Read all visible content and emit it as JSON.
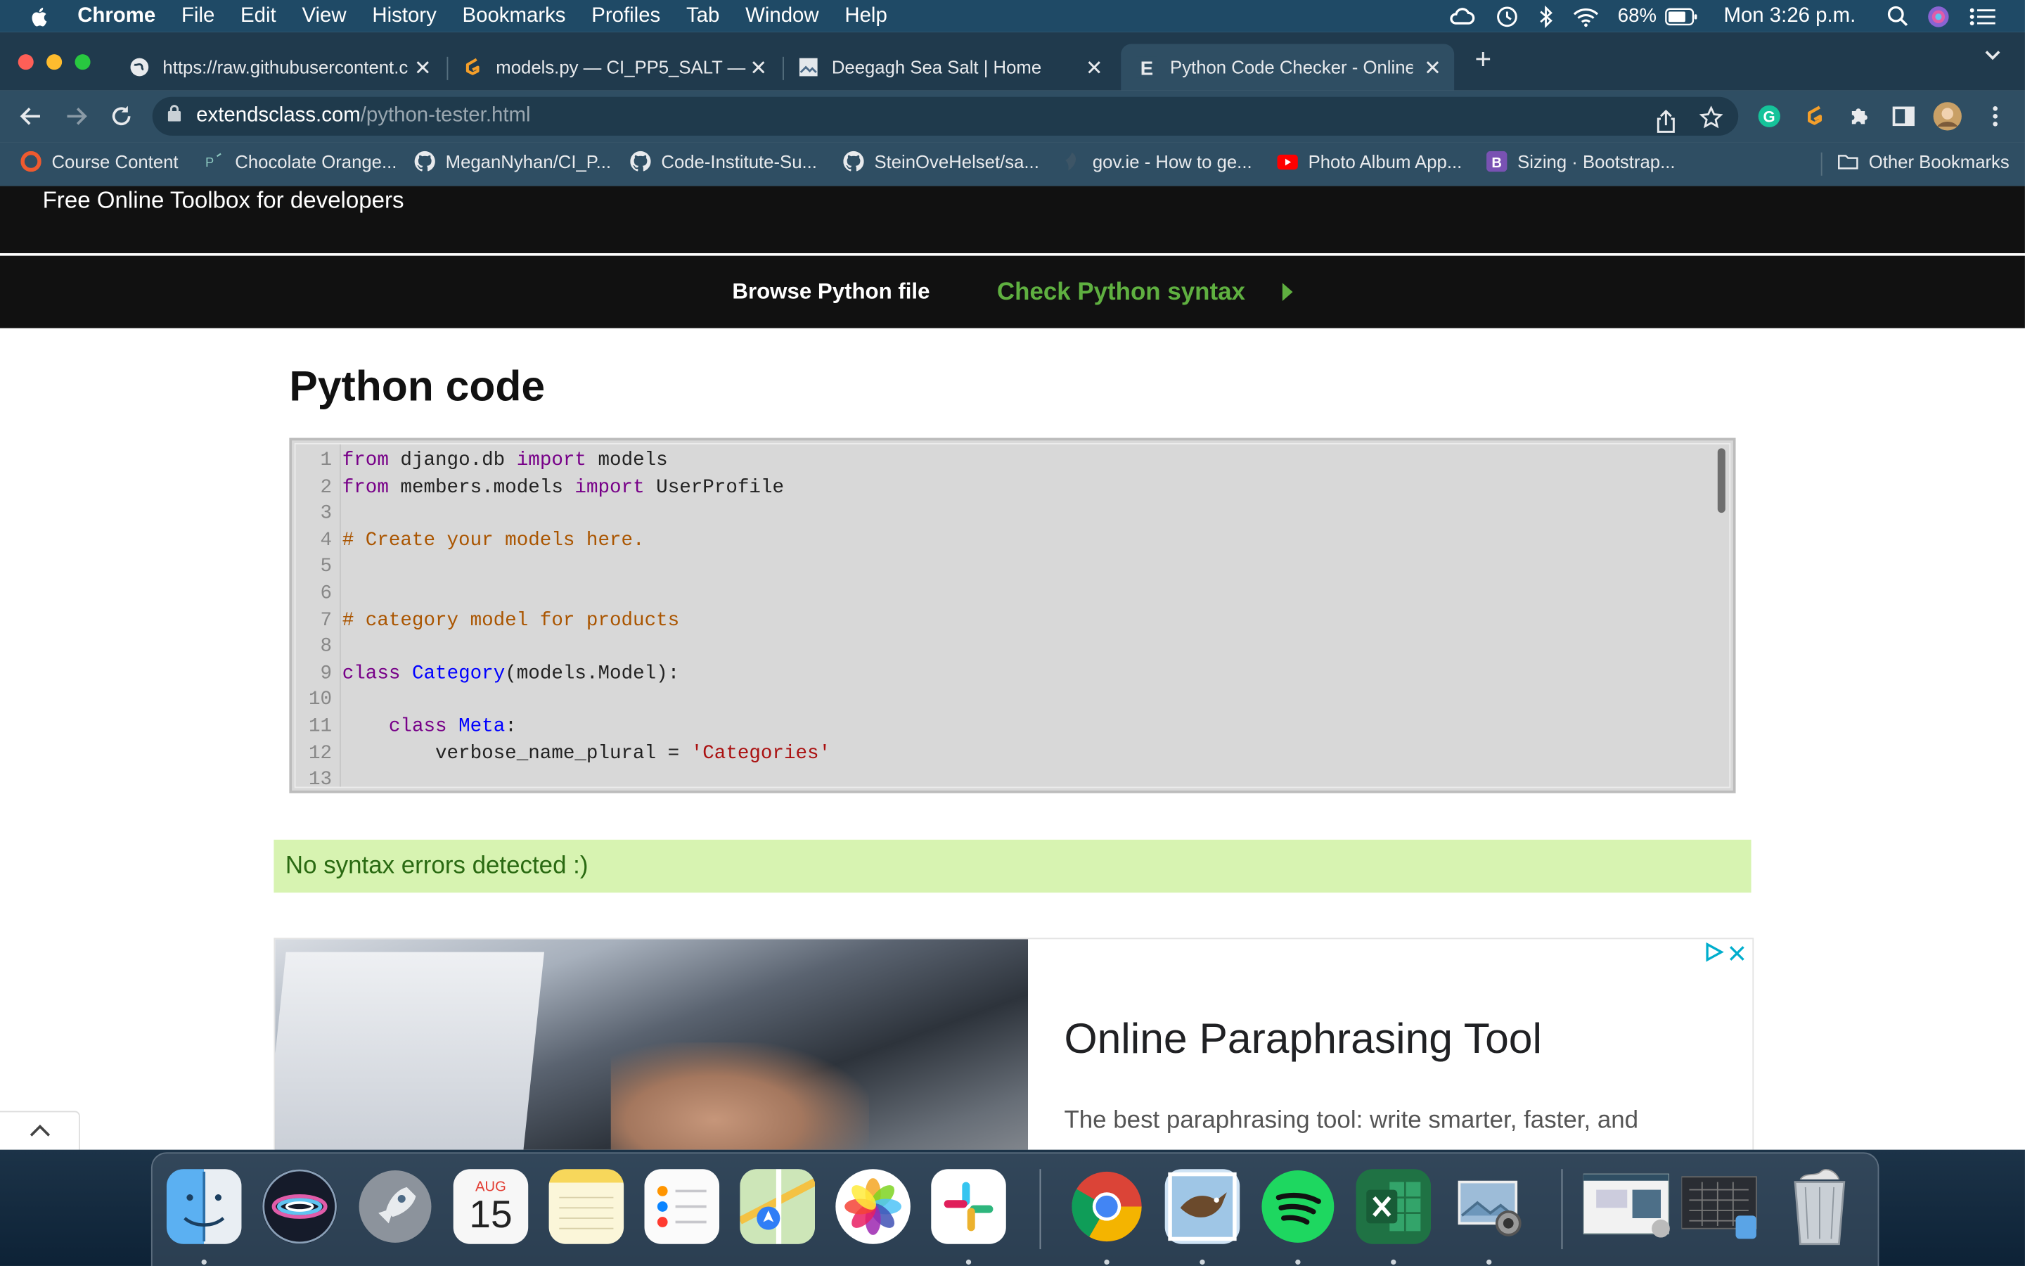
{
  "menubar": {
    "app": "Chrome",
    "items": [
      "File",
      "Edit",
      "View",
      "History",
      "Bookmarks",
      "Profiles",
      "Tab",
      "Window",
      "Help"
    ],
    "battery": "68%",
    "clock": "Mon 3:26 p.m."
  },
  "tabs": [
    {
      "title": "https://raw.githubusercontent.c",
      "icon": "globe-icon"
    },
    {
      "title": "models.py — CI_PP5_SALT — C",
      "icon": "gitpod-icon"
    },
    {
      "title": "Deegagh Sea Salt | Home",
      "icon": "site-thumbnail-icon"
    },
    {
      "title": "Python Code Checker - Online",
      "icon": "extendsclass-icon",
      "active": true
    }
  ],
  "address": {
    "host": "extendsclass.com",
    "path": "/python-tester.html"
  },
  "bookmarks": [
    {
      "label": "Course Content",
      "icon": "code-institute-icon"
    },
    {
      "label": "Chocolate Orange...",
      "icon": "page-icon"
    },
    {
      "label": "MeganNyhan/CI_P...",
      "icon": "github-icon"
    },
    {
      "label": "Code-Institute-Su...",
      "icon": "github-icon"
    },
    {
      "label": "SteinOveHelset/sa...",
      "icon": "github-icon"
    },
    {
      "label": "gov.ie - How to ge...",
      "icon": "govie-icon"
    },
    {
      "label": "Photo Album App...",
      "icon": "youtube-icon"
    },
    {
      "label": "Sizing · Bootstrap...",
      "icon": "bootstrap-icon"
    }
  ],
  "other_bookmarks": "Other Bookmarks",
  "site": {
    "tagline": "Free Online Toolbox for developers",
    "nav_browse": "Browse Python file",
    "nav_check": "Check Python syntax",
    "heading": "Python code",
    "result": "No syntax errors detected :)"
  },
  "code": [
    {
      "n": "1",
      "html": "<span class=\"kw\">from</span> django.db <span class=\"kw\">import</span> models"
    },
    {
      "n": "2",
      "html": "<span class=\"kw\">from</span> members.models <span class=\"kw\">import</span> UserProfile"
    },
    {
      "n": "3",
      "html": ""
    },
    {
      "n": "4",
      "html": "<span class=\"cmt\"># Create your models here.</span>"
    },
    {
      "n": "5",
      "html": ""
    },
    {
      "n": "6",
      "html": ""
    },
    {
      "n": "7",
      "html": "<span class=\"cmt\"># category model for products</span>"
    },
    {
      "n": "8",
      "html": ""
    },
    {
      "n": "9",
      "html": "<span class=\"kw\">class</span> <span class=\"cls\">Category</span>(models.Model):"
    },
    {
      "n": "10",
      "html": ""
    },
    {
      "n": "11",
      "html": "    <span class=\"kw\">class</span> <span class=\"cls\">Meta</span>:"
    },
    {
      "n": "12",
      "html": "        verbose_name_plural = <span class=\"str\">'Categories'</span>"
    },
    {
      "n": "13",
      "html": ""
    }
  ],
  "ad": {
    "title": "Online Paraphrasing Tool",
    "description": "The best paraphrasing tool: write smarter, faster, and"
  },
  "dock": {
    "calendar_month": "AUG",
    "calendar_day": "15",
    "apps": [
      "finder",
      "siri",
      "launchpad",
      "calendar",
      "notes",
      "reminders",
      "maps",
      "photos",
      "slack",
      "chrome",
      "preview-bird",
      "spotify",
      "excel",
      "image-capture",
      "window-1",
      "window-2",
      "trash"
    ]
  },
  "colors": {
    "menubar": "#1f4a66",
    "chrome_frame": "#2f4e63",
    "site_header": "#111111",
    "check_link": "#5fb040",
    "result_bg": "#d7f3b1",
    "result_text": "#2a6a12"
  }
}
